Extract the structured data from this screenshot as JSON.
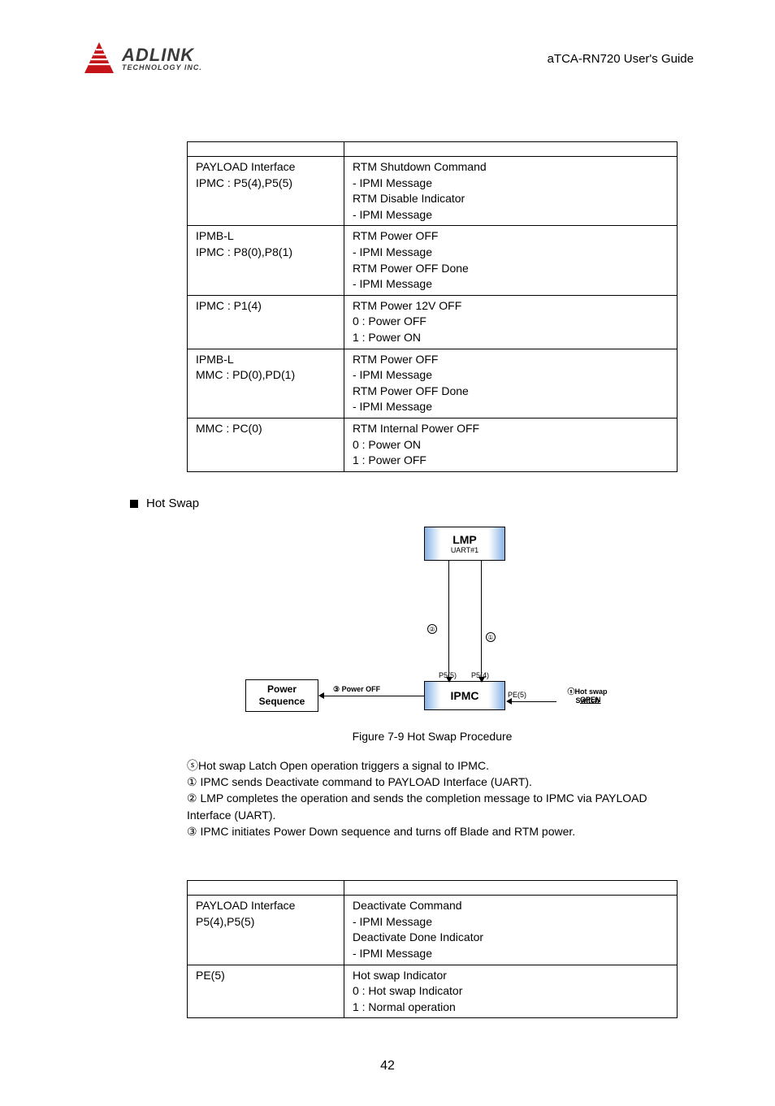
{
  "header": {
    "logo_title": "ADLINK",
    "logo_sub": "TECHNOLOGY INC.",
    "doc_title": "aTCA-RN720 User's Guide"
  },
  "table1": {
    "rows": [
      {
        "left": "PAYLOAD Interface\nIPMC : P5(4),P5(5)",
        "right": "RTM Shutdown Command\n - IPMI Message\nRTM Disable Indicator\n  -  IPMI Message"
      },
      {
        "left": "IPMB-L\nIPMC : P8(0),P8(1)",
        "right": "RTM Power OFF\n -  IPMI Message\nRTM Power OFF Done\n -  IPMI Message"
      },
      {
        "left": "IPMC : P1(4)",
        "right": "RTM Power 12V OFF\n0 : Power OFF\n1 : Power ON"
      },
      {
        "left": "IPMB-L\nMMC : PD(0),PD(1)",
        "right": "RTM Power OFF\n -  IPMI Message\nRTM Power OFF Done\n -  IPMI Message"
      },
      {
        "left": "MMC : PC(0)",
        "right": "RTM Internal Power OFF\n0 : Power ON\n1 : Power OFF"
      }
    ]
  },
  "section_label": "Hot Swap",
  "diagram": {
    "lmp": "LMP",
    "lmp_sub": "UART#1",
    "ipmc": "IPMC",
    "power_seq_l1": "Power",
    "power_seq_l2": "Sequence",
    "p55": "P5(5)",
    "p54": "P5(4)",
    "pe5": "PE(5)",
    "power_off": "③ Power OFF",
    "hotswap_label": "ⓢHot swap Switch",
    "hotswap_open": "OPEN",
    "circle2": "②",
    "circle1": "①"
  },
  "figure_caption": "Figure 7-9 Hot Swap Procedure",
  "steps": {
    "s": "ⓢHot swap Latch Open operation triggers a signal to IPMC.",
    "s1": "① IPMC sends Deactivate command to PAYLOAD Interface (UART).",
    "s2": "② LMP completes the operation and sends the completion message to IPMC via PAYLOAD Interface (UART).",
    "s3": "③ IPMC initiates Power Down sequence and turns off Blade and RTM power."
  },
  "table2": {
    "rows": [
      {
        "left": "PAYLOAD Interface\nP5(4),P5(5)",
        "right": "Deactivate Command\n - IPMI Message\nDeactivate Done Indicator\n  -  IPMI Message"
      },
      {
        "left": "PE(5)",
        "right": "Hot swap Indicator\n  0 : Hot swap Indicator\n  1 : Normal operation"
      }
    ]
  },
  "page_number": "42"
}
